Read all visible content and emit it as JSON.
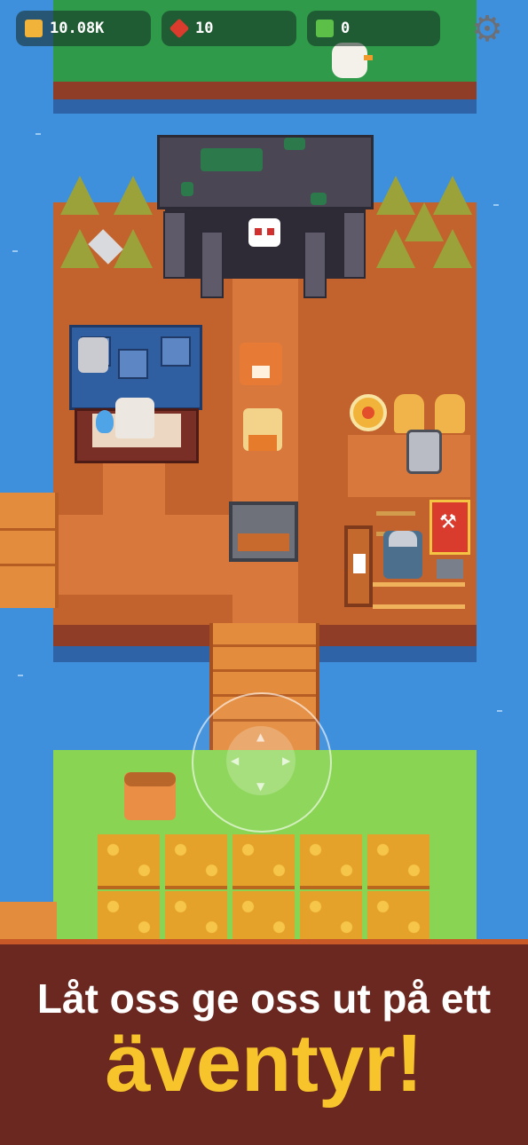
{
  "hud": {
    "coins": "10.08K",
    "gems": "10",
    "cards": "0",
    "coin_color": "#f2b33a",
    "gem_color": "#d93b2c",
    "card_color": "#5cbf48"
  },
  "icons": {
    "coin": "coin-icon",
    "gem": "red-gem-icon",
    "card": "green-card-icon",
    "settings": "gear-icon"
  },
  "caption": {
    "line1": "Låt oss ge oss ut på ett",
    "line2": "äventyr!"
  }
}
